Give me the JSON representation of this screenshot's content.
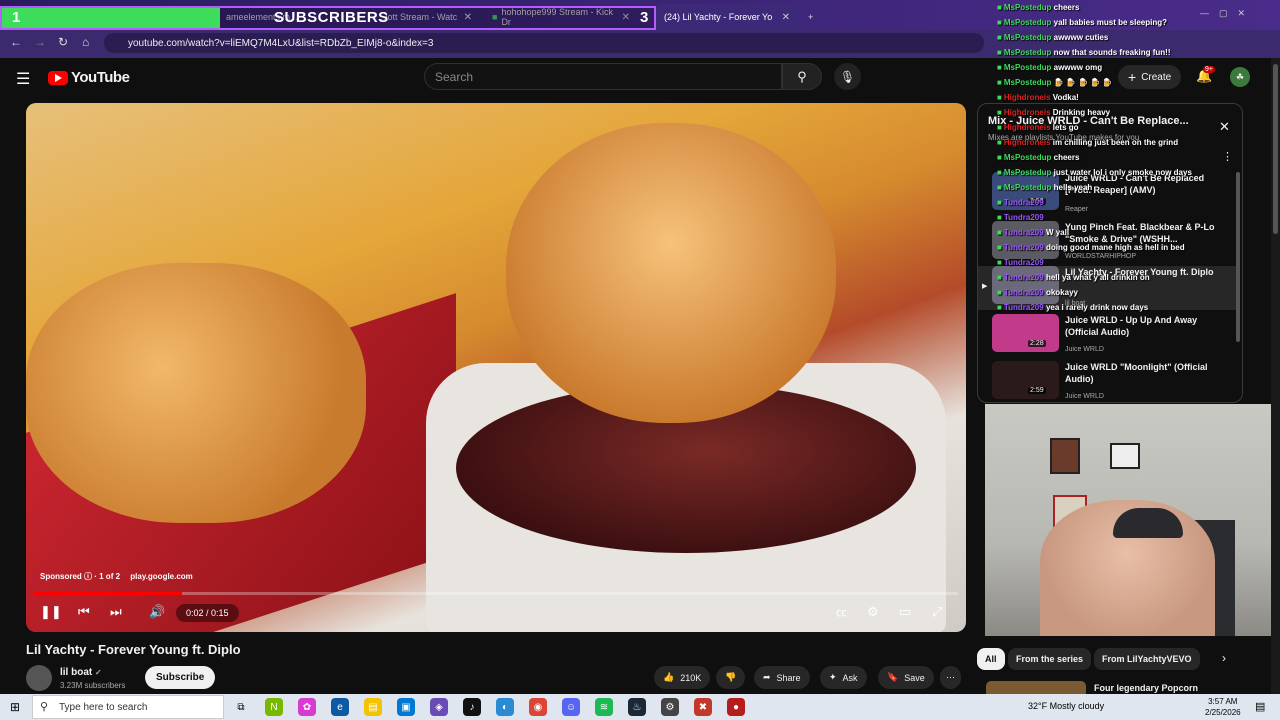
{
  "browser": {
    "tabs": [
      {
        "label": "ameelements m...",
        "close": "✕"
      },
      {
        "label": "...lott Stream - Watc",
        "close": "✕"
      },
      {
        "label": "hohohope999 Stream - Kick Dr",
        "close": "✕"
      },
      {
        "label": "(24) Lil Yachty - Forever Yo",
        "close": "✕"
      }
    ],
    "new_tab": "+",
    "url": "youtube.com/watch?v=liEMQ7M4LxU&list=RDbZb_EIMj8-o&index=3"
  },
  "overlay": {
    "left_number": "1",
    "label": "SUBSCRIBERS",
    "right_number": "3",
    "progress": 0.33
  },
  "youtube": {
    "logo": "YouTube",
    "search_placeholder": "Search",
    "create_label": "Create",
    "notification_count": "9+"
  },
  "player": {
    "sponsored": "Sponsored",
    "ad_count": "· 1 of 2",
    "ad_domain": "play.google.com",
    "time": "0:02 / 0:15",
    "progress": 0.16
  },
  "video": {
    "title": "Lil Yachty - Forever Young ft. Diplo",
    "channel": "lil boat",
    "verified": "✓",
    "subscribers": "3.23M subscribers",
    "subscribe_label": "Subscribe",
    "likes": "210K",
    "share_label": "Share",
    "ask_label": "Ask",
    "save_label": "Save"
  },
  "playlist": {
    "title": "Mix - Juice WRLD - Can't Be Replace...",
    "subtitle": "Mixes are playlists YouTube makes for you",
    "items": [
      {
        "title": "Juice WRLD - Can't Be Replaced [Prod. Reaper] (AMV)",
        "channel": "Reaper",
        "duration": "2:53"
      },
      {
        "title": "Yung Pinch Feat. Blackbear & P-Lo \"Smoke & Drive\" (WSHH...",
        "channel": "WORLDSTARHIPHOP",
        "duration": ""
      },
      {
        "title": "Lil Yachty - Forever Young ft. Diplo",
        "channel": "lil boat",
        "duration": ""
      },
      {
        "title": "Juice WRLD - Up Up And Away (Official Audio)",
        "channel": "Juice WRLD",
        "duration": "2:28"
      },
      {
        "title": "Juice WRLD \"Moonlight\" (Official Audio)",
        "channel": "Juice WRLD",
        "duration": "2:59"
      }
    ]
  },
  "chat": [
    {
      "user": "MsPostedup",
      "msg": "cheers",
      "color": "green"
    },
    {
      "user": "MsPostedup",
      "msg": "yall babies must be sleeping?",
      "color": "green"
    },
    {
      "user": "MsPostedup",
      "msg": "awwww cuties",
      "color": "green"
    },
    {
      "user": "MsPostedup",
      "msg": "now that sounds freaking fun!!",
      "color": "green"
    },
    {
      "user": "MsPostedup",
      "msg": "awwww omg",
      "color": "green"
    },
    {
      "user": "MsPostedup",
      "msg": "🍺 🍺 🍺 🍺 🍺",
      "color": "green"
    },
    {
      "user": "Highdroneis",
      "msg": "Vodka!",
      "color": "red"
    },
    {
      "user": "Highdroneis",
      "msg": "Drinking heavy",
      "color": "red"
    },
    {
      "user": "Highdroneis",
      "msg": "lets go",
      "color": "red"
    },
    {
      "user": "Highdroneis",
      "msg": "im chilling just been on the grind",
      "color": "red"
    },
    {
      "user": "MsPostedup",
      "msg": "cheers",
      "color": "green"
    },
    {
      "user": "MsPostedup",
      "msg": "just water lol i only smoke now days",
      "color": "green"
    },
    {
      "user": "MsPostedup",
      "msg": "hells yeah",
      "color": "green"
    },
    {
      "user": "Tundra209",
      "msg": "",
      "color": "purple"
    },
    {
      "user": "Tundra209",
      "msg": "",
      "color": "purple"
    },
    {
      "user": "Tundra209",
      "msg": "W yall",
      "color": "purple"
    },
    {
      "user": "Tundra209",
      "msg": "doing good mane high as hell in bed",
      "color": "purple"
    },
    {
      "user": "Tundra209",
      "msg": "",
      "color": "purple"
    },
    {
      "user": "Tundra209",
      "msg": "hell ya what y'all drinkin on",
      "color": "purple"
    },
    {
      "user": "Tundra209",
      "msg": "okokayy",
      "color": "purple"
    },
    {
      "user": "Tundra209",
      "msg": "yea i rarely drink now days",
      "color": "purple"
    }
  ],
  "chips": [
    "All",
    "From the series",
    "From LilYachtyVEVO"
  ],
  "next_up": "Four legendary Popcorn",
  "taskbar": {
    "search_placeholder": "Type here to search",
    "weather": "32°F  Mostly cloudy",
    "time": "3:57 AM",
    "date": "2/25/2026"
  }
}
